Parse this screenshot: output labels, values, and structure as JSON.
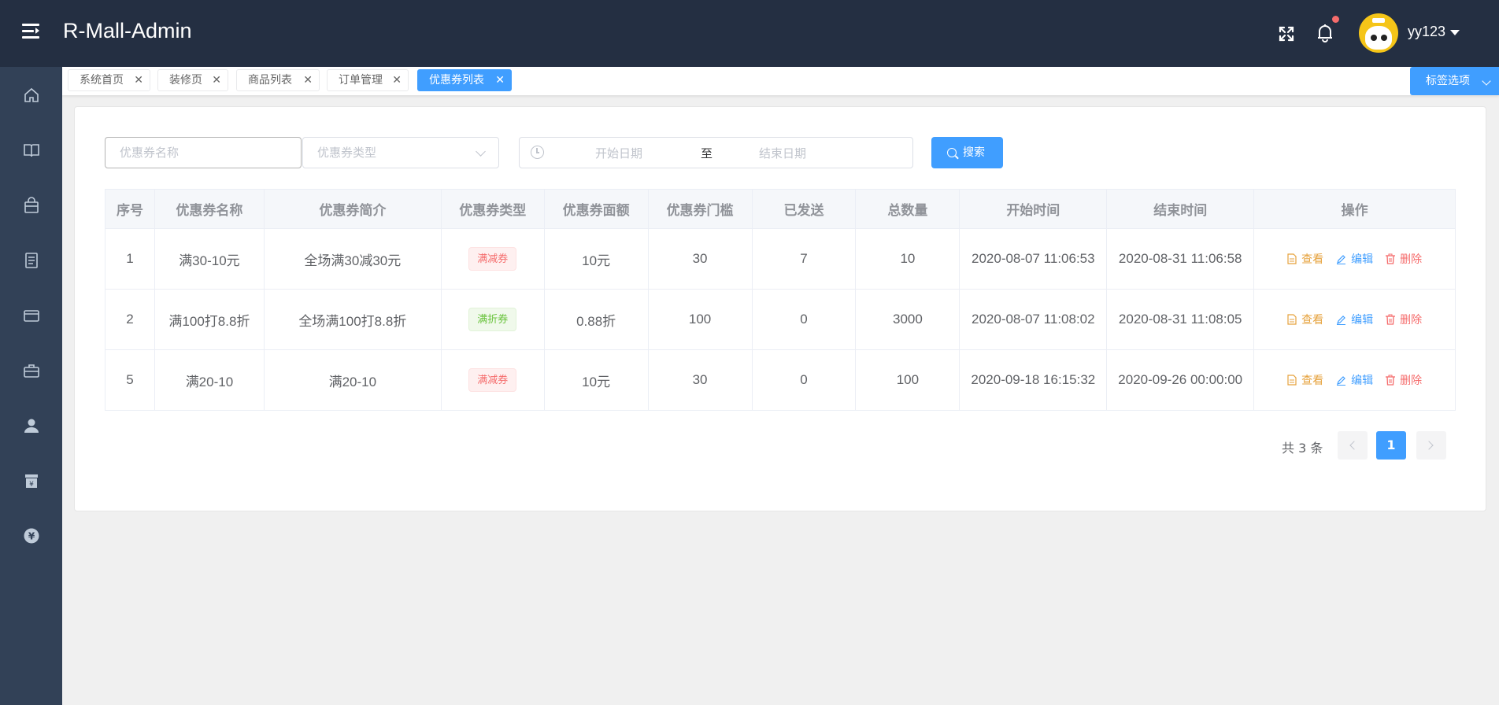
{
  "header": {
    "app_title": "R-Mall-Admin",
    "user_name": "yy123",
    "icons": [
      "menu-toggle-icon",
      "fullscreen-icon",
      "bell-icon",
      "avatar",
      "caret-down-icon"
    ]
  },
  "sidebar": {
    "items": [
      {
        "icon": "home-icon"
      },
      {
        "icon": "book-icon"
      },
      {
        "icon": "bag-icon"
      },
      {
        "icon": "document-icon"
      },
      {
        "icon": "card-icon"
      },
      {
        "icon": "briefcase-icon"
      },
      {
        "icon": "user-icon"
      },
      {
        "icon": "store-icon"
      },
      {
        "icon": "yen-icon"
      }
    ]
  },
  "tags": {
    "items": [
      {
        "label": "系统首页",
        "active": false
      },
      {
        "label": "装修页",
        "active": false
      },
      {
        "label": "商品列表",
        "active": false
      },
      {
        "label": "订单管理",
        "active": false
      },
      {
        "label": "优惠券列表",
        "active": true
      }
    ],
    "close_glyph": "✕",
    "options_label": "标签选项"
  },
  "filters": {
    "name_placeholder": "优惠券名称",
    "type_placeholder": "优惠券类型",
    "start_placeholder": "开始日期",
    "range_separator": "至",
    "end_placeholder": "结束日期",
    "search_label": "搜索"
  },
  "table": {
    "columns": [
      "序号",
      "优惠券名称",
      "优惠券简介",
      "优惠券类型",
      "优惠券面额",
      "优惠券门槛",
      "已发送",
      "总数量",
      "开始时间",
      "结束时间",
      "操作"
    ],
    "rows": [
      {
        "no": "1",
        "name": "满30-10元",
        "intro": "全场满30减30元",
        "type": "满减券",
        "type_color": "red",
        "amount": "10元",
        "threshold": "30",
        "sent": "7",
        "total": "10",
        "start": "2020-08-07 11:06:53",
        "end": "2020-08-31 11:06:58"
      },
      {
        "no": "2",
        "name": "满100打8.8折",
        "intro": "全场满100打8.8折",
        "type": "满折券",
        "type_color": "green",
        "amount": "0.88折",
        "threshold": "100",
        "sent": "0",
        "total": "3000",
        "start": "2020-08-07 11:08:02",
        "end": "2020-08-31 11:08:05"
      },
      {
        "no": "5",
        "name": "满20-10",
        "intro": "满20-10",
        "type": "满减券",
        "type_color": "red",
        "amount": "10元",
        "threshold": "30",
        "sent": "0",
        "total": "100",
        "start": "2020-09-18 16:15:32",
        "end": "2020-09-26 00:00:00"
      }
    ],
    "actions": {
      "view": "查看",
      "edit": "编辑",
      "delete": "删除"
    }
  },
  "pagination": {
    "total_text": "共 3 条",
    "current_page": "1"
  },
  "colors": {
    "header_bg": "#242f42",
    "sidebar_bg": "#324157",
    "primary": "#409eff",
    "warning": "#e6a23c",
    "danger": "#f56c6c",
    "success": "#67c23a"
  }
}
